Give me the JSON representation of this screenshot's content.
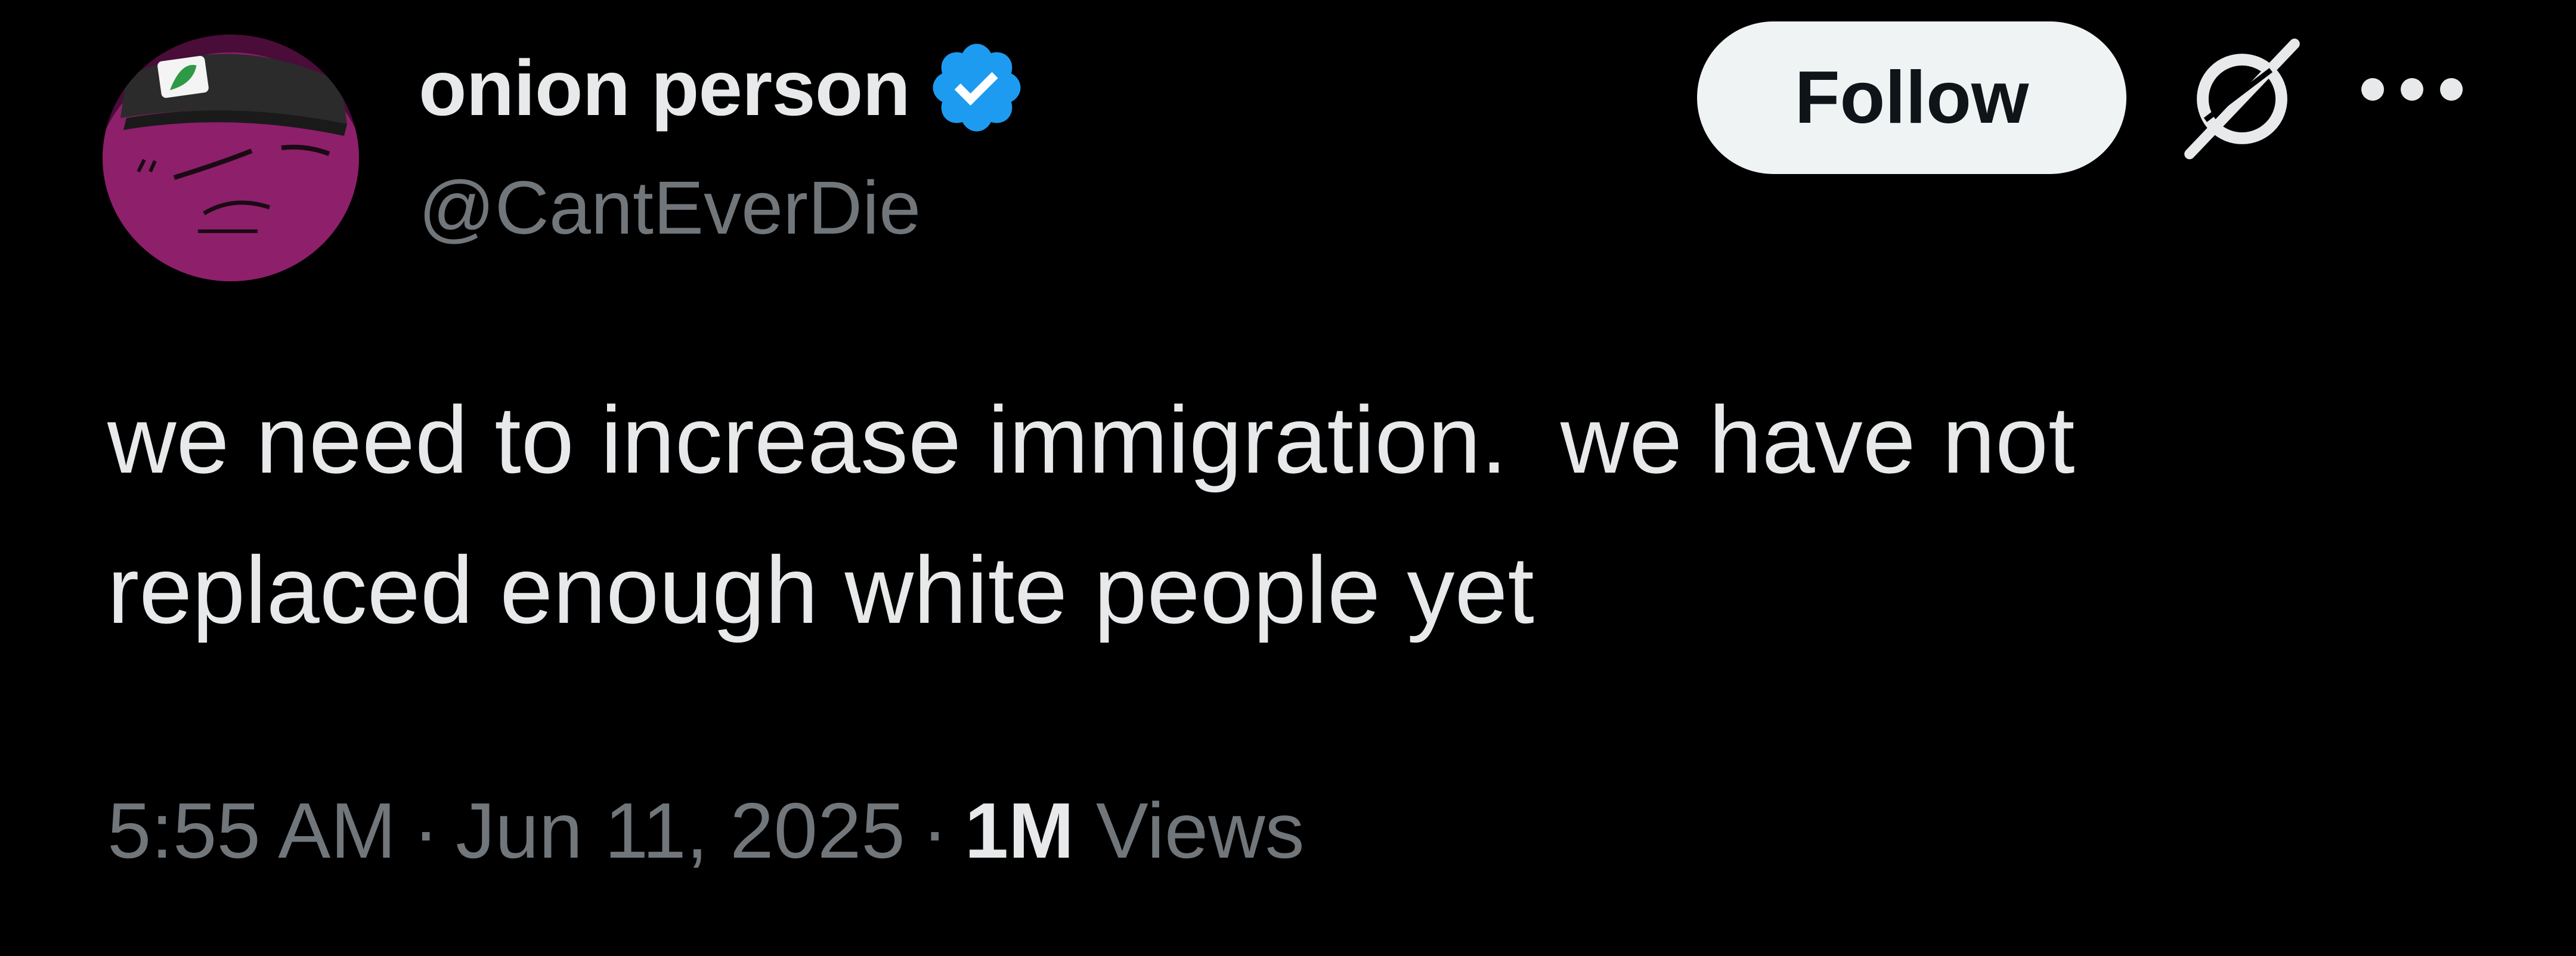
{
  "user": {
    "display_name": "onion person",
    "handle": "@CantEverDie",
    "verified": true,
    "avatar_colors": {
      "background": "#5c1045",
      "face": "#8e1f6b",
      "hat": "#2b2b2b",
      "badge": "#2e9a45"
    }
  },
  "actions": {
    "follow_label": "Follow",
    "grok_icon": "grok-icon",
    "more_icon": "more-icon"
  },
  "tweet": {
    "lines": [
      "we need to increase immigration.  we have not",
      "replaced enough white people yet"
    ]
  },
  "meta": {
    "time": "5:55 AM",
    "date": "Jun 11, 2025",
    "separator": "·",
    "views_count": "1M",
    "views_label": "Views"
  },
  "colors": {
    "background": "#000000",
    "primary_text": "#e7e9ea",
    "secondary_text": "#71767b",
    "verified_blue": "#1d9bf0",
    "follow_bg": "#eff3f4"
  }
}
